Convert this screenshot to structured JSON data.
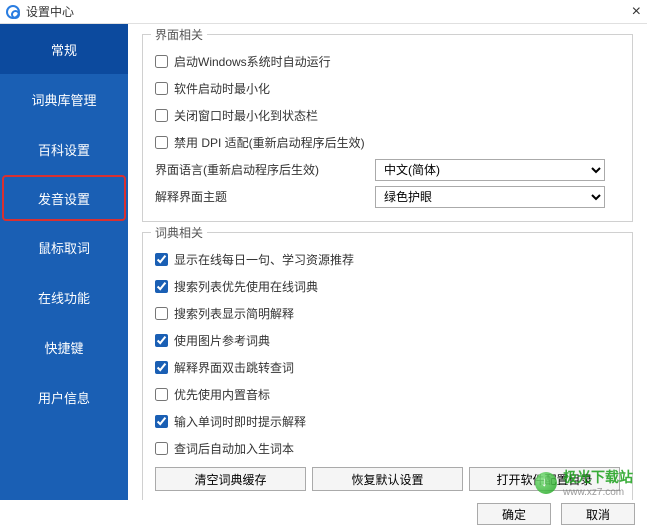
{
  "title": "设置中心",
  "sidebar": {
    "items": [
      {
        "label": "常规"
      },
      {
        "label": "词典库管理"
      },
      {
        "label": "百科设置"
      },
      {
        "label": "发音设置"
      },
      {
        "label": "鼠标取词"
      },
      {
        "label": "在线功能"
      },
      {
        "label": "快捷键"
      },
      {
        "label": "用户信息"
      }
    ]
  },
  "group_ui": {
    "legend": "界面相关",
    "opts": [
      {
        "label": "启动Windows系统时自动运行",
        "checked": false
      },
      {
        "label": "软件启动时最小化",
        "checked": false
      },
      {
        "label": "关闭窗口时最小化到状态栏",
        "checked": false
      },
      {
        "label": "禁用 DPI 适配(重新启动程序后生效)",
        "checked": false
      }
    ],
    "lang_label": "界面语言(重新启动程序后生效)",
    "lang_value": "中文(简体)",
    "theme_label": "解释界面主题",
    "theme_value": "绿色护眼"
  },
  "group_dict": {
    "legend": "词典相关",
    "opts": [
      {
        "label": "显示在线每日一句、学习资源推荐",
        "checked": true
      },
      {
        "label": "搜索列表优先使用在线词典",
        "checked": true
      },
      {
        "label": "搜索列表显示简明解释",
        "checked": false
      },
      {
        "label": "使用图片参考词典",
        "checked": true
      },
      {
        "label": "解释界面双击跳转查词",
        "checked": true
      },
      {
        "label": "优先使用内置音标",
        "checked": false
      },
      {
        "label": "输入单词时即时提示解释",
        "checked": true
      },
      {
        "label": "查词后自动加入生词本",
        "checked": false
      }
    ],
    "btns": {
      "clear": "清空词典缓存",
      "restore": "恢复默认设置",
      "open": "打开软件配置目录"
    }
  },
  "footer": {
    "ok": "确定",
    "cancel": "取消"
  },
  "watermark": {
    "name": "极光下载站",
    "url": "www.xz7.com"
  }
}
